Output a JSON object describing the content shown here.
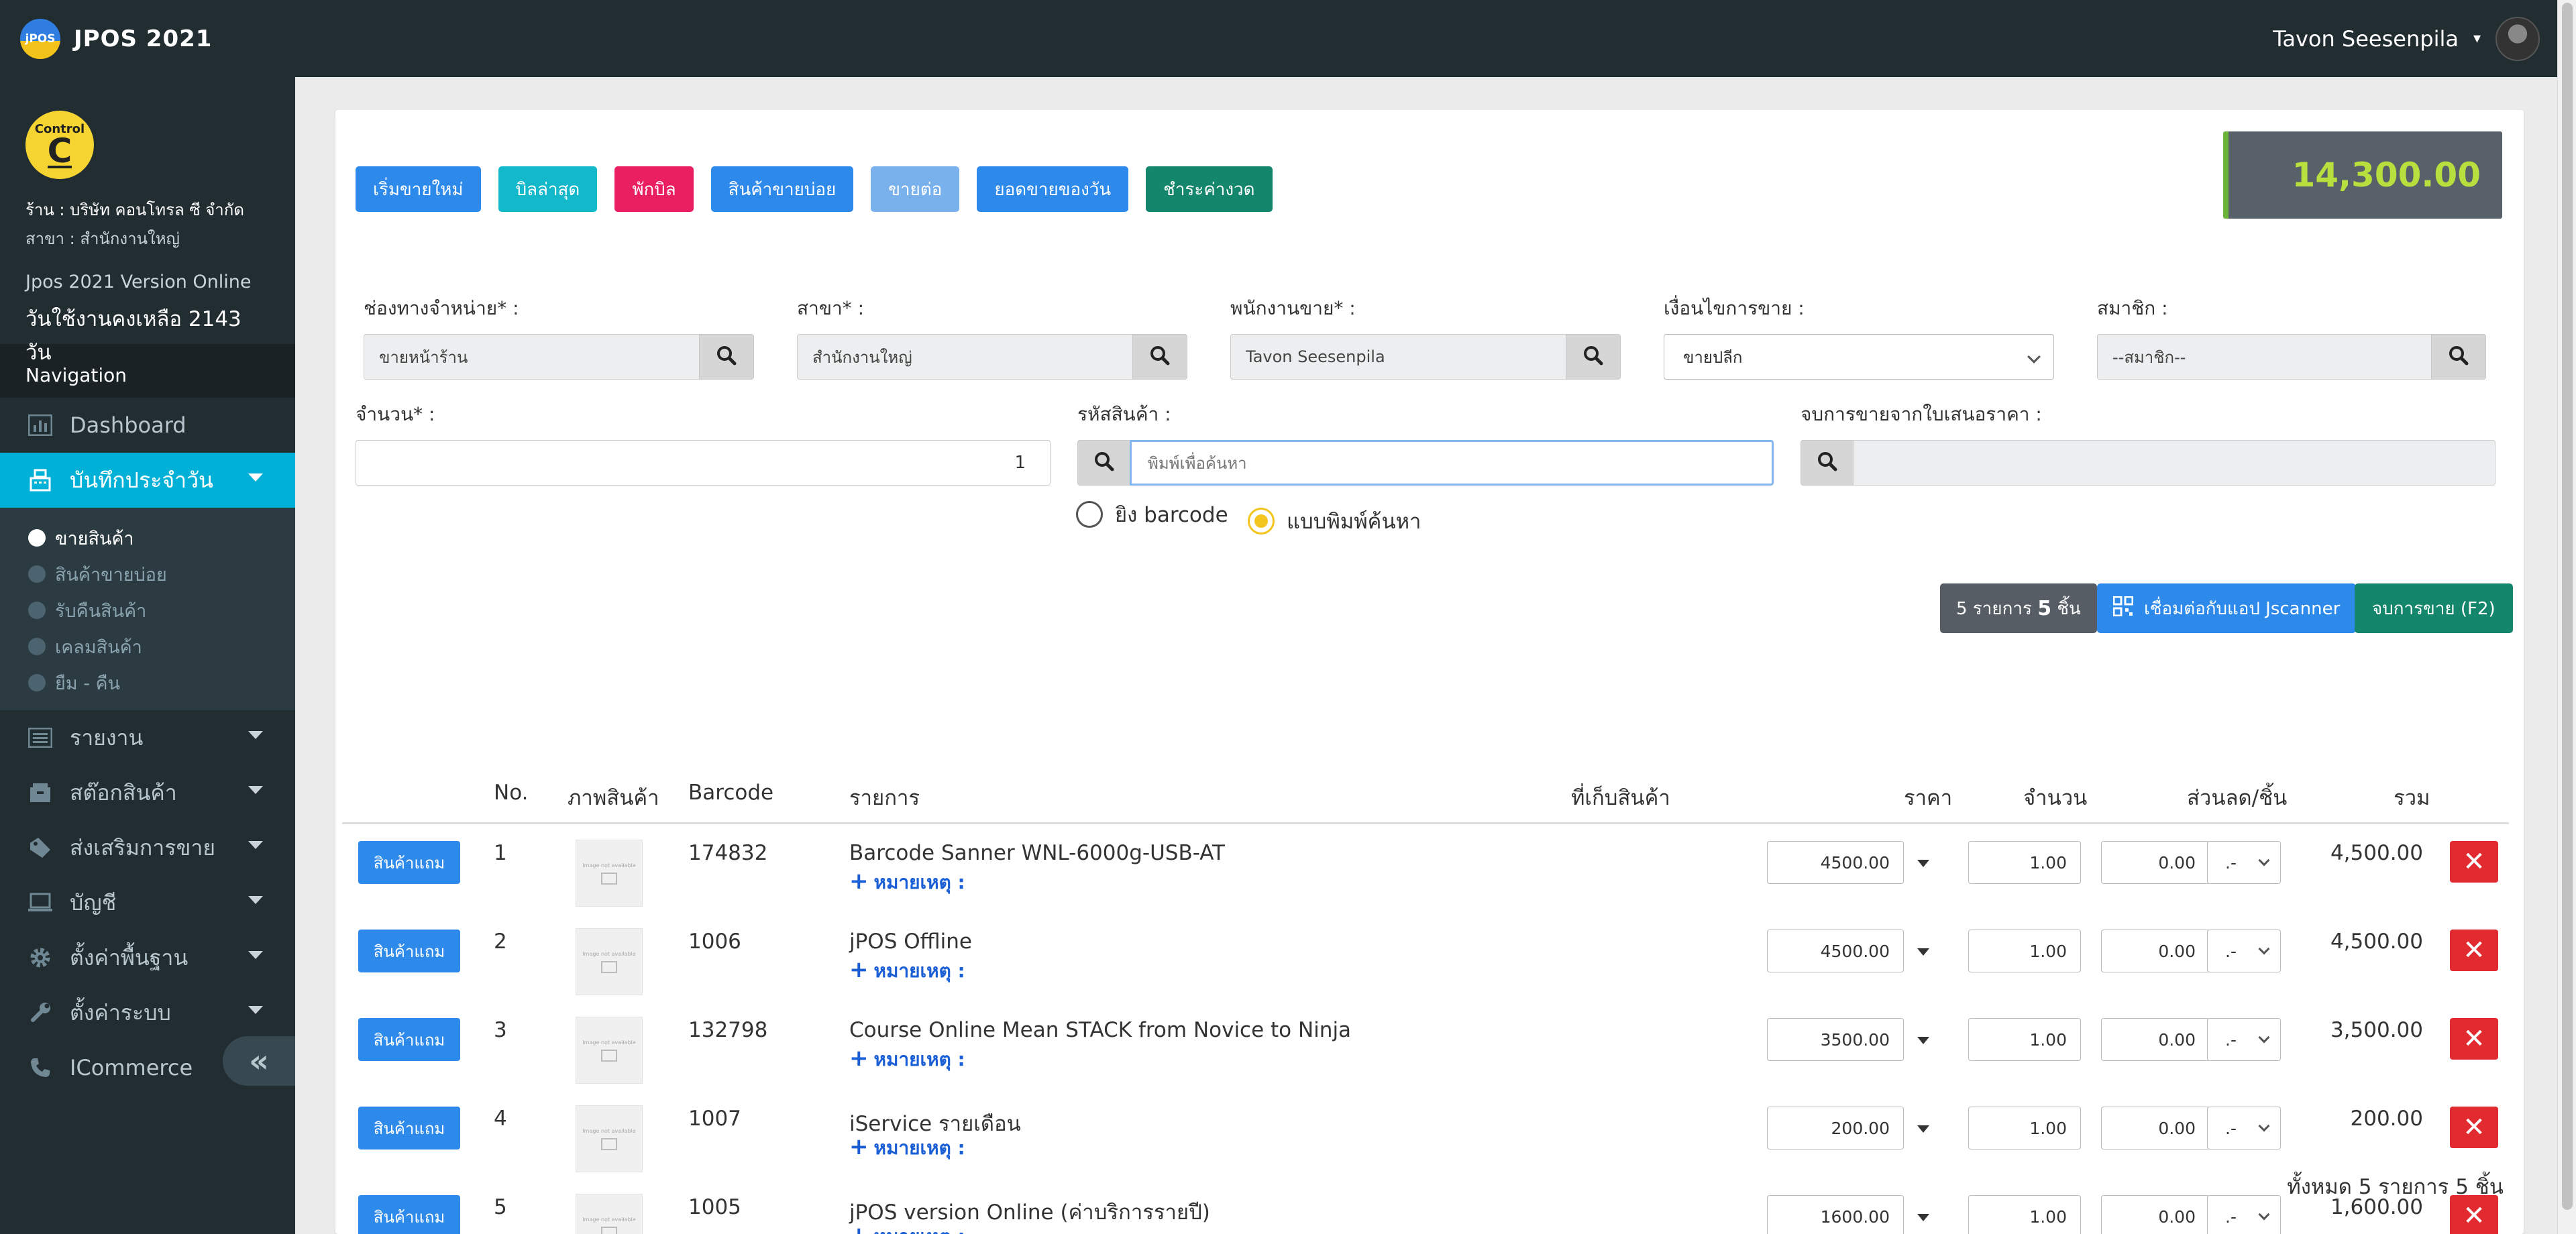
{
  "app": {
    "title": "JPOS 2021",
    "logo_text": "jPOS"
  },
  "user": {
    "name": "Tavon Seesenpila"
  },
  "shop": {
    "logo_top": "Control",
    "logo_letter": "C",
    "name": "ร้าน : บริษัท คอนโทรล ซี จำกัด",
    "branch": "สาขา : สำนักงานใหญ่",
    "version": "Jpos 2021 Version Online",
    "days_left": "วันใช้งานคงเหลือ 2143 วัน"
  },
  "nav": {
    "header": "Navigation",
    "items": [
      {
        "label": "Dashboard",
        "icon": "chart-bar-icon"
      },
      {
        "label": "บันทึกประจำวัน",
        "icon": "cash-register-icon"
      },
      {
        "label": "รายงาน",
        "icon": "list-icon"
      },
      {
        "label": "สต๊อกสินค้า",
        "icon": "box-icon"
      },
      {
        "label": "ส่งเสริมการขาย",
        "icon": "tag-icon"
      },
      {
        "label": "บัญชี",
        "icon": "laptop-icon"
      },
      {
        "label": "ตั้งค่าพื้นฐาน",
        "icon": "gear-icon"
      },
      {
        "label": "ตั้งค่าระบบ",
        "icon": "wrench-icon"
      },
      {
        "label": "ICommerce",
        "icon": "phone-icon"
      }
    ],
    "subitems": [
      "ขายสินค้า",
      "สินค้าขายบ่อย",
      "รับคืนสินค้า",
      "เคลมสินค้า",
      "ยืม - คืน"
    ]
  },
  "toolbar": {
    "buttons": [
      "เริ่มขายใหม่",
      "บิลล่าสุด",
      "พักบิล",
      "สินค้าขายบ่อย",
      "ขายต่อ",
      "ยอดขายของวัน",
      "ชำระค่างวด"
    ]
  },
  "total": "14,300.00",
  "form": {
    "channel_label": "ช่องทางจำหน่าย* :",
    "channel_value": "ขายหน้าร้าน",
    "branch_label": "สาขา* :",
    "branch_value": "สำนักงานใหญ่",
    "staff_label": "พนักงานขาย* :",
    "staff_value": "Tavon Seesenpila",
    "condition_label": "เงื่อนไขการขาย :",
    "condition_value": "ขายปลีก",
    "member_label": "สมาชิก :",
    "member_placeholder": "--สมาชิก--",
    "qty_label": "จำนวน* :",
    "qty_value": "1",
    "product_label": "รหัสสินค้า :",
    "product_placeholder": "พิมพ์เพื่อค้นหา",
    "quote_label": "จบการขายจากใบเสนอราคา :",
    "radio_barcode": "ยิง barcode",
    "radio_search": "แบบพิมพ์ค้นหา"
  },
  "actions": {
    "count_prefix": "5 รายการ",
    "count_bold": "5",
    "count_suffix": "ชิ้น",
    "connect": "เชื่อมต่อกับแอป Jscanner",
    "finish": "จบการขาย (F2)"
  },
  "table": {
    "headers": [
      "No.",
      "ภาพสินค้า",
      "Barcode",
      "รายการ",
      "ที่เก็บสินค้า",
      "ราคา",
      "จำนวน",
      "ส่วนลด/ชิ้น",
      "รวม"
    ],
    "free_button": "สินค้าแถม",
    "note_label": "หมายเหตุ :",
    "image_placeholder": "Image not available",
    "discount_option": ".-",
    "rows": [
      {
        "no": "1",
        "barcode": "174832",
        "name": "Barcode Sanner WNL-6000g-USB-AT",
        "price": "4500.00",
        "qty": "1.00",
        "discount": "0.00",
        "total": "4,500.00"
      },
      {
        "no": "2",
        "barcode": "1006",
        "name": "jPOS Offline",
        "price": "4500.00",
        "qty": "1.00",
        "discount": "0.00",
        "total": "4,500.00"
      },
      {
        "no": "3",
        "barcode": "132798",
        "name": "Course Online Mean STACK from Novice to Ninja",
        "price": "3500.00",
        "qty": "1.00",
        "discount": "0.00",
        "total": "3,500.00"
      },
      {
        "no": "4",
        "barcode": "1007",
        "name": "iService รายเดือน",
        "price": "200.00",
        "qty": "1.00",
        "discount": "0.00",
        "total": "200.00"
      },
      {
        "no": "5",
        "barcode": "1005",
        "name": "jPOS version Online (ค่าบริการรายปี)",
        "price": "1600.00",
        "qty": "1.00",
        "discount": "0.00",
        "total": "1,600.00"
      }
    ],
    "summary": "ทั้งหมด 5 รายการ 5 ชิ้น"
  }
}
